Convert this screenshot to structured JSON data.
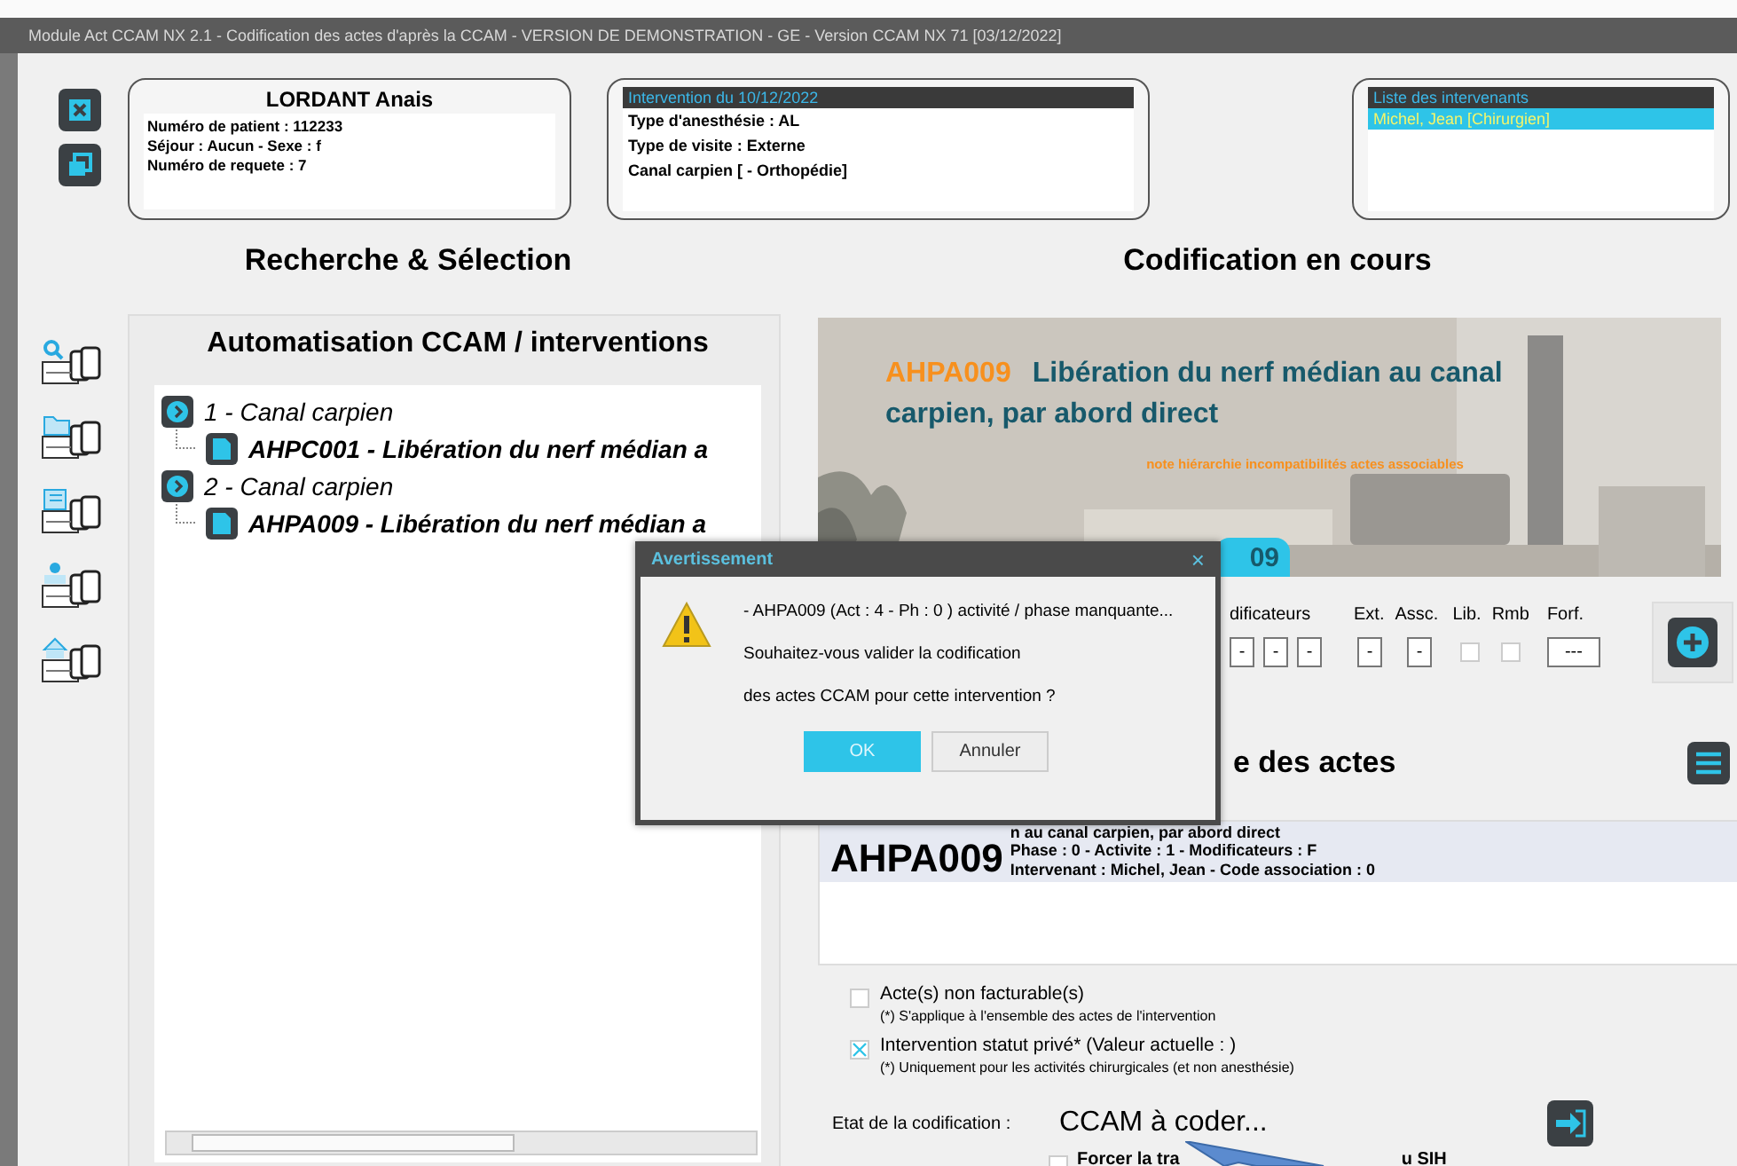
{
  "window": {
    "title": "Module Act CCAM NX 2.1 - Codification des actes d'après la CCAM - VERSION DE DEMONSTRATION - GE - Version CCAM NX 71 [03/12/2022]"
  },
  "patient": {
    "name": "LORDANT Anais",
    "lines": [
      "Numéro de patient : 112233",
      "Séjour : Aucun - Sexe : f",
      "Numéro de requete : 7"
    ]
  },
  "intervention": {
    "title": "Intervention du 10/12/2022",
    "lines": [
      "Type d'anesthésie : AL",
      "Type de visite : Externe",
      "Canal carpien [ - Orthopédie]"
    ]
  },
  "intervenants": {
    "title": "Liste des intervenants",
    "items": [
      {
        "label": "Michel, Jean [Chirurgien]",
        "selected": true
      }
    ]
  },
  "left": {
    "title": "Recherche & Sélection",
    "panel_title": "Automatisation CCAM / interventions",
    "tree": [
      {
        "label": "1 - Canal carpien",
        "children": [
          {
            "label": "AHPC001 - Libération du nerf médian a"
          }
        ]
      },
      {
        "label": "2 - Canal carpien",
        "children": [
          {
            "label": "AHPA009 - Libération du nerf médian a"
          }
        ]
      }
    ]
  },
  "right": {
    "title": "Codification en cours",
    "banner": {
      "code": "AHPA009",
      "label": "Libération du nerf médian au canal carpien, par abord direct",
      "links": [
        "note",
        "hiérarchie",
        "incompatibilités",
        "actes associables"
      ],
      "tab": "09"
    },
    "modifiers": {
      "headers": [
        "dificateurs",
        "Ext.",
        "Assc.",
        "Lib.",
        "Rmb",
        "Forf."
      ],
      "mods": [
        "-",
        "-",
        "-"
      ],
      "ext": "-",
      "assc": "-",
      "lib": false,
      "rmb": false,
      "forf": "---"
    },
    "acts_title": "e des actes",
    "acts": [
      {
        "code": "AHPA009",
        "lines": [
          "n au canal carpien, par abord direct",
          "Phase : 0 - Activite : 1 - Modificateurs : F",
          "Intervenant : Michel, Jean - Code association : 0"
        ],
        "selected": true
      }
    ],
    "options": [
      {
        "label": "Acte(s) non facturable(s)",
        "note": "(*) S'applique à l'ensemble des actes de l'intervention",
        "checked": false
      },
      {
        "label": "Intervention statut privé* (Valeur actuelle :  )",
        "note": "(*) Uniquement pour les activités chirurgicales (et non anesthésie)",
        "checked": true
      }
    ],
    "status": {
      "label": "Etat de la codification :",
      "value": "CCAM à coder..."
    },
    "force": {
      "parts": [
        "Forcer la tra",
        "u SIH"
      ],
      "checked": false
    }
  },
  "dialog": {
    "title": "Avertissement",
    "close": "×",
    "lines": [
      "- AHPA009 (Act : 4 - Ph : 0 ) activité / phase manquante...",
      "Souhaitez-vous valider la codification",
      "des actes CCAM pour cette intervention ?"
    ],
    "buttons": [
      {
        "label": "OK",
        "kind": "primary"
      },
      {
        "label": "Annuler",
        "kind": "secondary"
      }
    ]
  }
}
